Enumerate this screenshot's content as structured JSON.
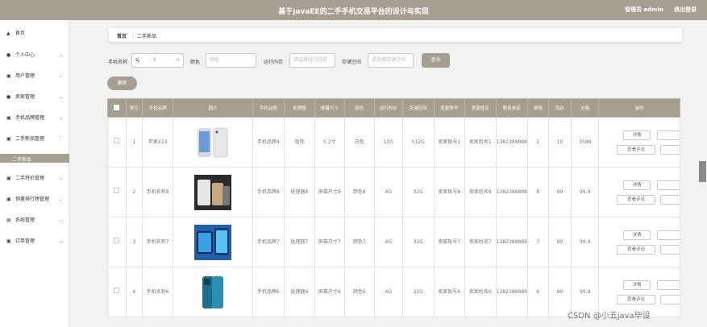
{
  "header": {
    "title": "基于javaEE的二手手机交易平台的设计与实现",
    "user": "管理员 admin",
    "logout": "退出登录"
  },
  "sidebar": {
    "items": [
      {
        "label": "首页",
        "icon": "home-icon"
      },
      {
        "label": "个人中心",
        "icon": "user-icon"
      },
      {
        "label": "用户管理",
        "icon": "users-icon"
      },
      {
        "label": "卖家管理",
        "icon": "seller-icon"
      },
      {
        "label": "手机品牌管理",
        "icon": "brand-icon"
      },
      {
        "label": "二手新品管理",
        "icon": "phone-icon"
      },
      {
        "label": "二手特价管理",
        "icon": "tag-icon"
      },
      {
        "label": "销量排行榜管理",
        "icon": "rank-icon"
      },
      {
        "label": "系统管理",
        "icon": "system-icon"
      },
      {
        "label": "订单管理",
        "icon": "order-icon"
      }
    ],
    "submenu": "二手新品"
  },
  "breadcrumb": {
    "home": "首页",
    "separator": "⋮",
    "current": "二手新品"
  },
  "filters": {
    "name_label": "手机名称",
    "name_value": "sj",
    "color_label": "颜色",
    "color_placeholder": "颜色",
    "memory_label": "运行内存",
    "memory_placeholder": "请选择运行内存",
    "storage_label": "存储空间",
    "storage_placeholder": "请选择存储空间",
    "search_button": "查询"
  },
  "actions": {
    "delete_button": "删除"
  },
  "table": {
    "headers": [
      "索引",
      "手机名称",
      "图片",
      "手机品牌",
      "处理器",
      "屏幕尺寸",
      "颜色",
      "运行内存",
      "存储空间",
      "卖家账号",
      "卖家姓名",
      "联系电话",
      "单限",
      "库存",
      "价格",
      "操作"
    ],
    "rows": [
      {
        "index": "1",
        "name": "苹果X13",
        "brand": "手机品牌4",
        "cpu": "戏院",
        "screen": "5.2寸",
        "color": "白色",
        "memory": "12G",
        "storage": "512G",
        "seller_account": "卖家账号1",
        "seller_name": "卖家姓名1",
        "phone": "13823888881",
        "limit": "2",
        "stock": "10",
        "price": "3588"
      },
      {
        "index": "2",
        "name": "手机名称8",
        "brand": "手机品牌8",
        "cpu": "处理器8",
        "screen": "屏幕尺寸8",
        "color": "颜色8",
        "memory": "4G",
        "storage": "32G",
        "seller_account": "卖家账号8",
        "seller_name": "卖家姓名8",
        "phone": "13823888888",
        "limit": "8",
        "stock": "99",
        "price": "99.9"
      },
      {
        "index": "3",
        "name": "手机名称7",
        "brand": "手机品牌7",
        "cpu": "处理器7",
        "screen": "屏幕尺寸7",
        "color": "颜色7",
        "memory": "4G",
        "storage": "32G",
        "seller_account": "卖家账号7",
        "seller_name": "卖家姓名7",
        "phone": "13823888887",
        "limit": "7",
        "stock": "99",
        "price": "99.9"
      },
      {
        "index": "4",
        "name": "手机名称6",
        "brand": "手机品牌6",
        "cpu": "处理器6",
        "screen": "屏幕尺寸6",
        "color": "颜色6",
        "memory": "4G",
        "storage": "32G",
        "seller_account": "卖家账号6",
        "seller_name": "卖家姓名6",
        "phone": "13823888886",
        "limit": "6",
        "stock": "99",
        "price": "99.9"
      }
    ],
    "op_detail": "详情",
    "op_review": "查看评论"
  },
  "watermark": "CSDN @小五java毕设"
}
